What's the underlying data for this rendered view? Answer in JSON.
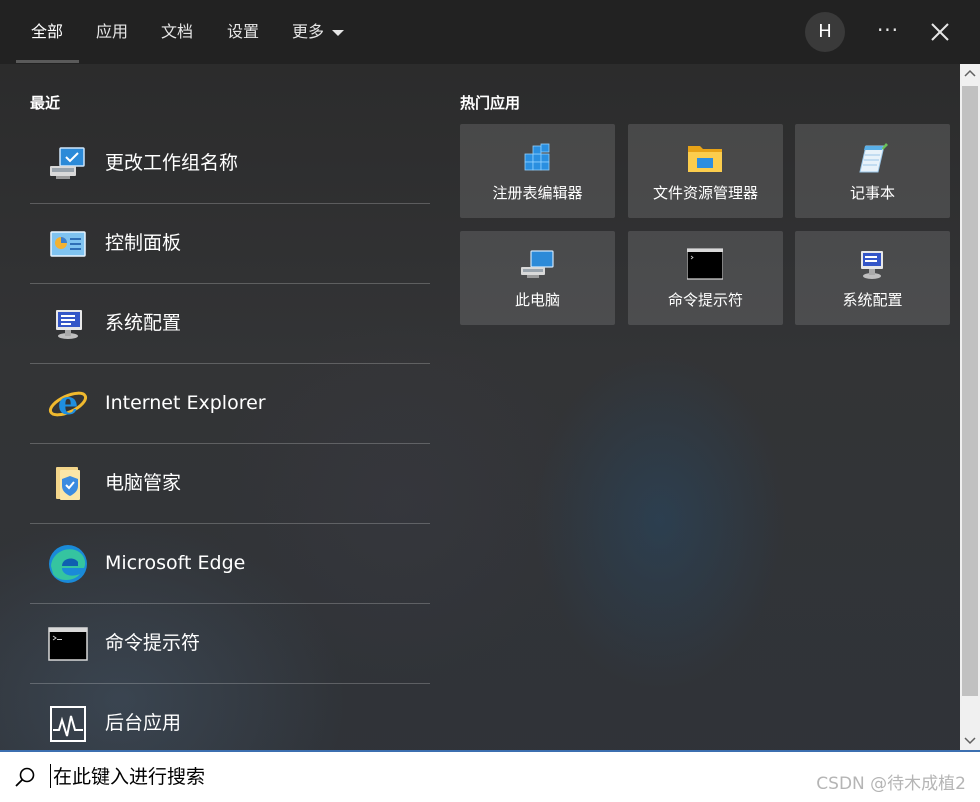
{
  "colors": {
    "accent": "#3c6fb0",
    "topbar_bg": "#222222",
    "tile_bg": "rgba(255,255,255,0.13)"
  },
  "tabs": [
    {
      "label": "全部",
      "active": true
    },
    {
      "label": "应用"
    },
    {
      "label": "文档"
    },
    {
      "label": "设置"
    },
    {
      "label": "更多"
    }
  ],
  "header": {
    "avatar_initial": "H",
    "more_label": "···"
  },
  "recent": {
    "title": "最近",
    "items": [
      {
        "label": "更改工作组名称",
        "icon": "computer-settings-icon"
      },
      {
        "label": "控制面板",
        "icon": "control-panel-icon"
      },
      {
        "label": "系统配置",
        "icon": "system-config-icon"
      },
      {
        "label": "Internet Explorer",
        "icon": "internet-explorer-icon"
      },
      {
        "label": "电脑管家",
        "icon": "pc-manager-icon"
      },
      {
        "label": "Microsoft Edge",
        "icon": "edge-icon"
      },
      {
        "label": "命令提示符",
        "icon": "command-prompt-icon"
      },
      {
        "label": "后台应用",
        "icon": "background-apps-icon"
      }
    ]
  },
  "hot_apps": {
    "title": "热门应用",
    "items": [
      {
        "label": "注册表编辑器",
        "icon": "registry-editor-icon"
      },
      {
        "label": "文件资源管理器",
        "icon": "file-explorer-icon"
      },
      {
        "label": "记事本",
        "icon": "notepad-icon"
      },
      {
        "label": "此电脑",
        "icon": "this-pc-icon"
      },
      {
        "label": "命令提示符",
        "icon": "command-prompt-icon"
      },
      {
        "label": "系统配置",
        "icon": "system-config-icon"
      }
    ]
  },
  "search": {
    "placeholder": "在此键入进行搜索",
    "value": ""
  },
  "watermark": "CSDN @待木成植2"
}
